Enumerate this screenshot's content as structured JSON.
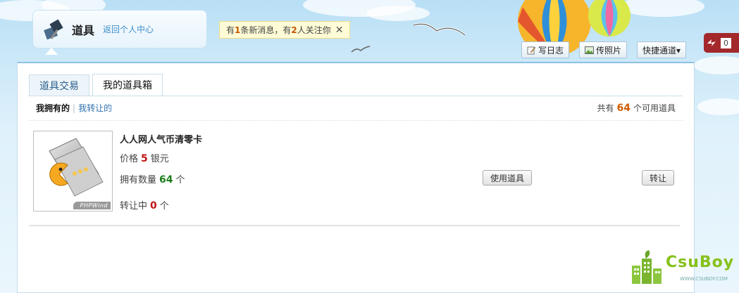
{
  "header": {
    "app_title": "道具",
    "back_link": "返回个人中心",
    "icon": "hammer-icon"
  },
  "notice": {
    "text_1": "有",
    "msg_count": "1",
    "text_2": "条新消息，有",
    "follow_count": "2",
    "text_3": "人关注你",
    "close": "✕"
  },
  "toolbar": {
    "write_blog": "写日志",
    "upload_photo": "传照片",
    "quick_access": "快捷通道▾"
  },
  "side_badge": {
    "value": "0"
  },
  "tabs": [
    {
      "label": "道具交易",
      "active": false
    },
    {
      "label": "我的道具箱",
      "active": true
    }
  ],
  "subnav": {
    "owned": "我拥有的",
    "separator": "|",
    "transferred": "我转让的",
    "total_prefix": "共有",
    "total_count": "64",
    "total_suffix": "个可用道具"
  },
  "item": {
    "name": "人人网人气币清零卡",
    "price_label": "价格",
    "price_value": "5",
    "price_unit": "银元",
    "qty_label": "拥有数量",
    "qty_value": "64",
    "qty_unit": "个",
    "transfer_label": "转让中",
    "transfer_value": "0",
    "transfer_unit": "个",
    "thumb_brand": "PHPWind",
    "use_button": "使用道具",
    "transfer_button": "转让"
  },
  "watermark": {
    "text": "CsuBoy",
    "url": "WWW.CSUBOY.COM"
  },
  "colors": {
    "accent_orange": "#d05b00",
    "price_red": "#c21414",
    "qty_green": "#1b7e1b",
    "link_blue": "#2f72b0"
  }
}
